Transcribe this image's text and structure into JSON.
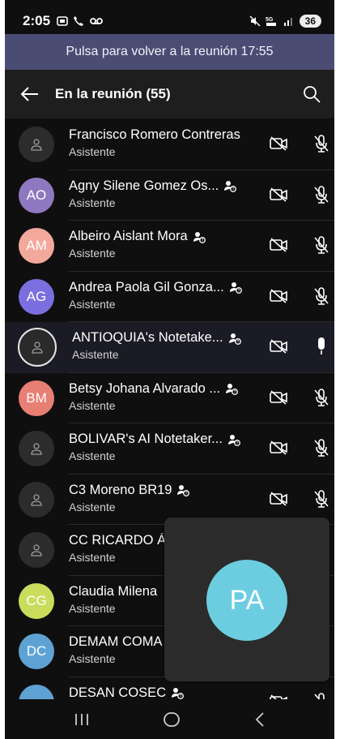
{
  "status_bar": {
    "time": "2:05",
    "battery": "36"
  },
  "banner": {
    "text": "Pulsa para volver a la reunión 17:55"
  },
  "header": {
    "title": "En la reunión (55)"
  },
  "participants": [
    {
      "name": "Francisco Romero Contreras",
      "role": "Asistente",
      "initials": "",
      "color": "",
      "mic_on": false,
      "badge": false
    },
    {
      "name": "Agny Silene Gomez  Os...",
      "role": "Asistente",
      "initials": "AO",
      "color": "#8e78c0",
      "mic_on": false,
      "badge": true
    },
    {
      "name": "Albeiro Aislant Mora",
      "role": "Asistente",
      "initials": "AM",
      "color": "#f2a99c",
      "mic_on": false,
      "badge": true
    },
    {
      "name": "Andrea Paola Gil Gonza...",
      "role": "Asistente",
      "initials": "AG",
      "color": "#7b6fe0",
      "mic_on": false,
      "badge": true
    },
    {
      "name": "ANTIOQUIA's Notetake...",
      "role": "Asistente",
      "initials": "",
      "color": "",
      "mic_on": true,
      "badge": true
    },
    {
      "name": "Betsy Johana Alvarado ...",
      "role": "Asistente",
      "initials": "BM",
      "color": "#e87f74",
      "mic_on": false,
      "badge": true
    },
    {
      "name": "BOLIVAR's AI Notetaker...",
      "role": "Asistente",
      "initials": "",
      "color": "",
      "mic_on": false,
      "badge": true
    },
    {
      "name": "C3 Moreno BR19",
      "role": "Asistente",
      "initials": "",
      "color": "",
      "mic_on": false,
      "badge": true
    },
    {
      "name": "CC RICARDO Á",
      "role": "Asistente",
      "initials": "",
      "color": "",
      "mic_on": false,
      "badge": false
    },
    {
      "name": "Claudia Milena",
      "role": "Asistente",
      "initials": "CG",
      "color": "#c9dc5c",
      "mic_on": false,
      "badge": false
    },
    {
      "name": "DEMAM COMA",
      "role": "Asistente",
      "initials": "DC",
      "color": "#5ea2d4",
      "mic_on": false,
      "badge": false
    },
    {
      "name": "DESAN COSEC",
      "role": "",
      "initials": "",
      "color": "#5ea2d4",
      "mic_on": false,
      "badge": true
    }
  ],
  "floating_tile": {
    "initials": "PA",
    "color": "#6ccde0"
  }
}
